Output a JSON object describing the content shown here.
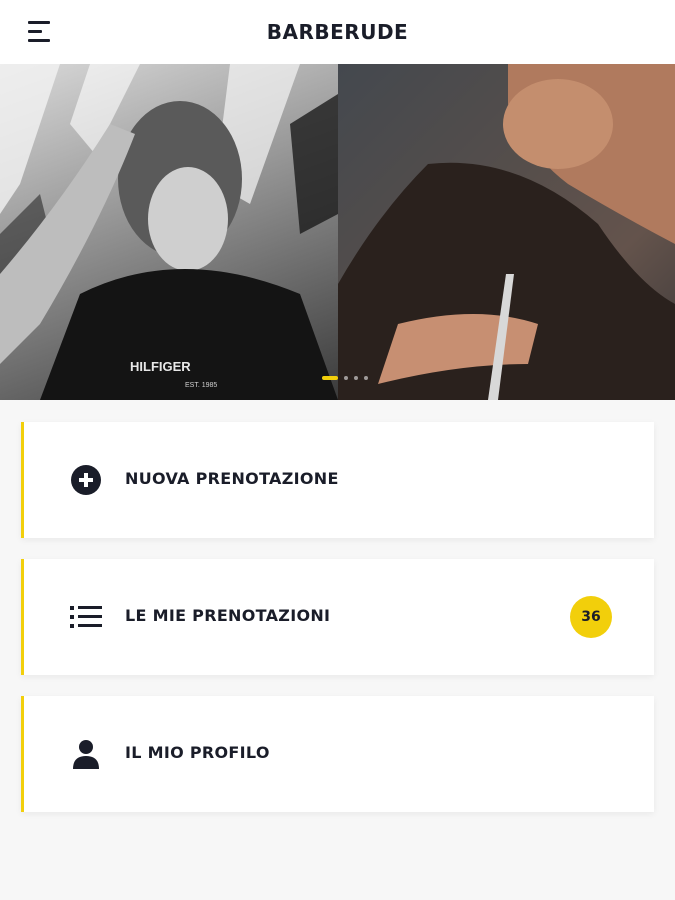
{
  "app": {
    "title": "BARBERUDE",
    "accent_color": "#f2cf0b",
    "text_color": "#1a1d29",
    "menu_icon": "hamburger-menu-icon"
  },
  "carousel": {
    "slides": [
      {
        "description_icon": "model-portrait-photo",
        "shirt_text": "HILFIGER",
        "shirt_sub": "EST. 1985"
      },
      {
        "description_icon": "beard-trim-photo"
      }
    ],
    "active_dot": 0,
    "dot_count": 4
  },
  "menu": [
    {
      "label": "NUOVA PRENOTAZIONE",
      "icon": "plus-circle-icon"
    },
    {
      "label": "LE MIE PRENOTAZIONI",
      "icon": "list-icon",
      "badge": "36"
    },
    {
      "label": "IL MIO PROFILO",
      "icon": "user-icon"
    }
  ]
}
